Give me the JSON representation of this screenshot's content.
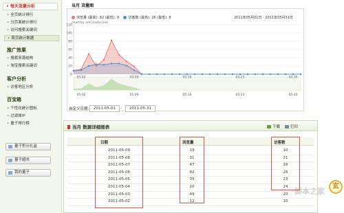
{
  "sidebar": {
    "top_item": "每天流量分析",
    "group1": [
      "全页统计排行",
      "分页面统计排行",
      "访问搜索关键词",
      "首页统计数据"
    ],
    "head2": "推广效果",
    "group2": [
      "搜索来源结构",
      "淘宝搜索关键词"
    ],
    "head3": "客户分析",
    "group3": [
      "访客地区分析"
    ],
    "head4": "百宝箱",
    "group4": [
      "个性化统计图标",
      "过滤掉IP",
      "量子排行榜"
    ],
    "buttons": [
      "量子积分礼盒",
      "量子超市",
      "我的量子"
    ]
  },
  "chart_section": {
    "tab": "当月  流量图",
    "legend_pv": "浏览量 (最高): 82 (最低): 9",
    "legend_uv": "访客数 (最高): 26 (最低): 8",
    "range": "2011年05月01日 - 2011年05月31日",
    "credit": "chart by amCharts.com"
  },
  "chart_data": {
    "type": "area",
    "x": [
      "05-01",
      "05-02",
      "05-03",
      "05-04",
      "05-05",
      "05-06",
      "05-07",
      "05-08",
      "05-09",
      "05-10",
      "05-11",
      "05-12",
      "05-13",
      "05-14",
      "05-15",
      "05-16",
      "05-17",
      "05-18",
      "05-19",
      "05-20",
      "05-21",
      "05-22",
      "05-23",
      "05-24",
      "05-25",
      "05-26",
      "05-27",
      "05-28",
      "05-29",
      "05-30",
      "05-31"
    ],
    "series": [
      {
        "name": "浏览量",
        "color": "#e07b6c",
        "values": [
          9,
          12,
          49,
          20,
          35,
          82,
          47,
          31,
          19,
          0,
          0,
          0,
          0,
          0,
          0,
          0,
          0,
          0,
          0,
          0,
          0,
          0,
          0,
          0,
          0,
          0,
          0,
          0,
          0,
          0,
          0
        ]
      },
      {
        "name": "访客数",
        "color": "#4a8ed8",
        "values": [
          8,
          10,
          20,
          24,
          23,
          26,
          26,
          21,
          10,
          0,
          0,
          0,
          0,
          0,
          0,
          0,
          0,
          0,
          0,
          0,
          0,
          0,
          0,
          0,
          0,
          0,
          0,
          0,
          0,
          0,
          0
        ]
      }
    ],
    "ylim": [
      0,
      120
    ],
    "yticks": [
      0,
      20,
      40,
      60,
      80,
      100,
      120
    ],
    "xticks": [
      "05-02",
      "05-09",
      "05-16",
      "05-23",
      "05-30"
    ],
    "grid": true
  },
  "date_filter": {
    "label": "自定义日期:",
    "start": "2011-05-01",
    "sep": "-",
    "end": "2011-05-31"
  },
  "report": {
    "title": "当月  数据详细报表",
    "download": "下载",
    "print": "打印",
    "columns": [
      "日期",
      "浏览量",
      "访客数"
    ],
    "rows": [
      [
        "2011-05-09",
        "19",
        "10"
      ],
      [
        "2011-05-08",
        "31",
        "21"
      ],
      [
        "2011-05-07",
        "47",
        "26"
      ],
      [
        "2011-05-06",
        "82",
        "26"
      ],
      [
        "2011-05-05",
        "35",
        "23"
      ],
      [
        "2011-05-04",
        "20",
        "24"
      ],
      [
        "2011-05-03",
        "49",
        "20"
      ],
      [
        "2011-05-02",
        "12",
        "10"
      ]
    ]
  },
  "watermark": {
    "text": "脚本之家",
    "seal": "玄"
  }
}
